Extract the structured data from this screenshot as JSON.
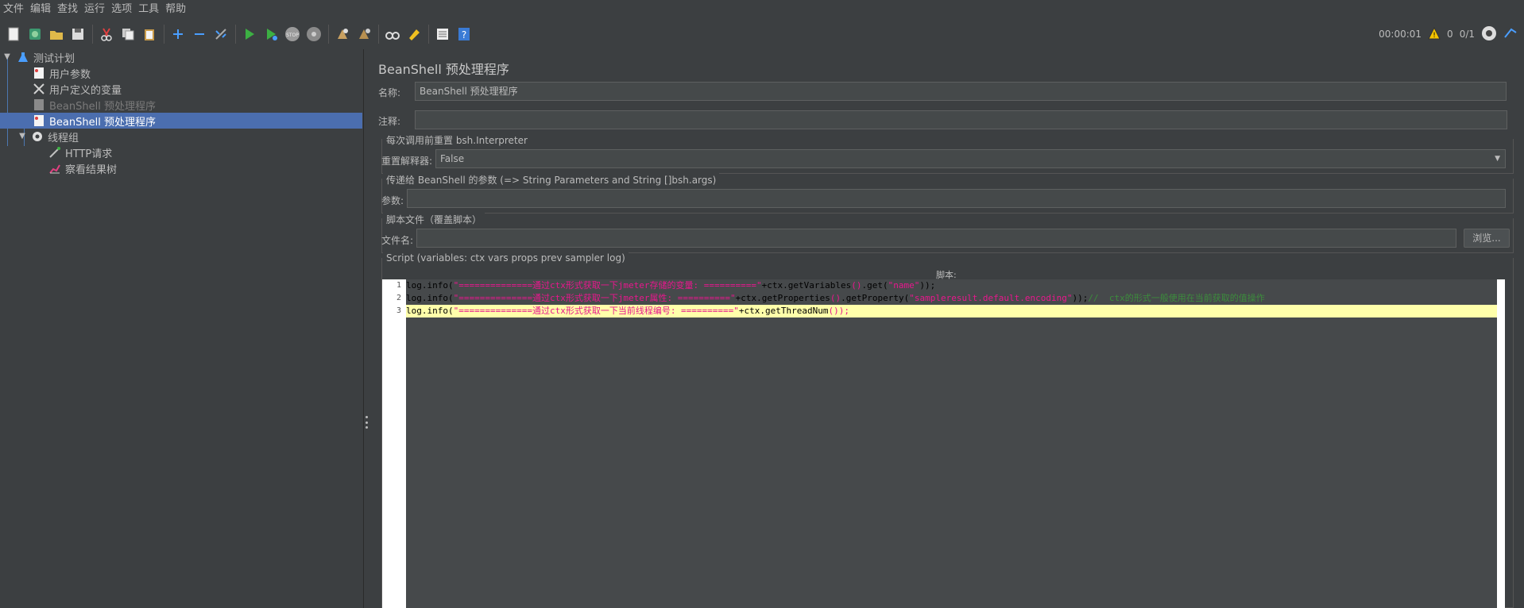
{
  "menu": [
    "文件",
    "编辑",
    "查找",
    "运行",
    "选项",
    "工具",
    "帮助"
  ],
  "toolbar_right": {
    "elapsed": "00:00:01",
    "warnings": "0",
    "threads": "0/1"
  },
  "tree": {
    "root": "测试计划",
    "items": [
      {
        "label": "用户参数"
      },
      {
        "label": "用户定义的变量"
      },
      {
        "label": "BeanShell 预处理程序"
      },
      {
        "label": "BeanShell 预处理程序"
      },
      {
        "label": "线程组"
      },
      {
        "label": "HTTP请求"
      },
      {
        "label": "察看结果树"
      }
    ]
  },
  "panel": {
    "title": "BeanShell 预处理程序",
    "name_label": "名称:",
    "name_value": "BeanShell 预处理程序",
    "comment_label": "注释:",
    "comment_value": "",
    "reset_group": "每次调用前重置 bsh.Interpreter",
    "reset_label": "重置解释器:",
    "reset_value": "False",
    "params_group": "传递给 BeanShell 的参数 (=> String Parameters and String []bsh.args)",
    "params_label": "参数:",
    "params_value": "",
    "file_group": "脚本文件（覆盖脚本）",
    "file_label": "文件名:",
    "file_value": "",
    "browse_button": "浏览...",
    "script_group": "Script (variables: ctx vars props prev sampler log)",
    "script_label": "脚本:"
  },
  "script": {
    "line_numbers": [
      "1",
      "2",
      "3"
    ],
    "line1": {
      "a": "log.info(",
      "s": "\"==============通过ctx形式获取一下jmeter存储的变量: ==========\"",
      "b": "+ctx.getVariables",
      "p1": "()",
      "c": ".get(",
      "s2": "\"name\"",
      "e": "));"
    },
    "line2": {
      "a": "log.info(",
      "s": "\"==============通过ctx形式获取一下jmeter属性: ==========\"",
      "b": "+ctx.getProperties",
      "p1": "()",
      "c": ".getProperty(",
      "s2": "\"sampleresult.default.encoding\"",
      "e": "));",
      "cmt": "//  ctx的形式一般使用在当前获取的值操作"
    },
    "line3": {
      "a": "log.info(",
      "s": "\"==============通过ctx形式获取一下当前线程编号: ==========\"",
      "b": "+ctx.getThreadNum",
      "e": "());"
    }
  }
}
